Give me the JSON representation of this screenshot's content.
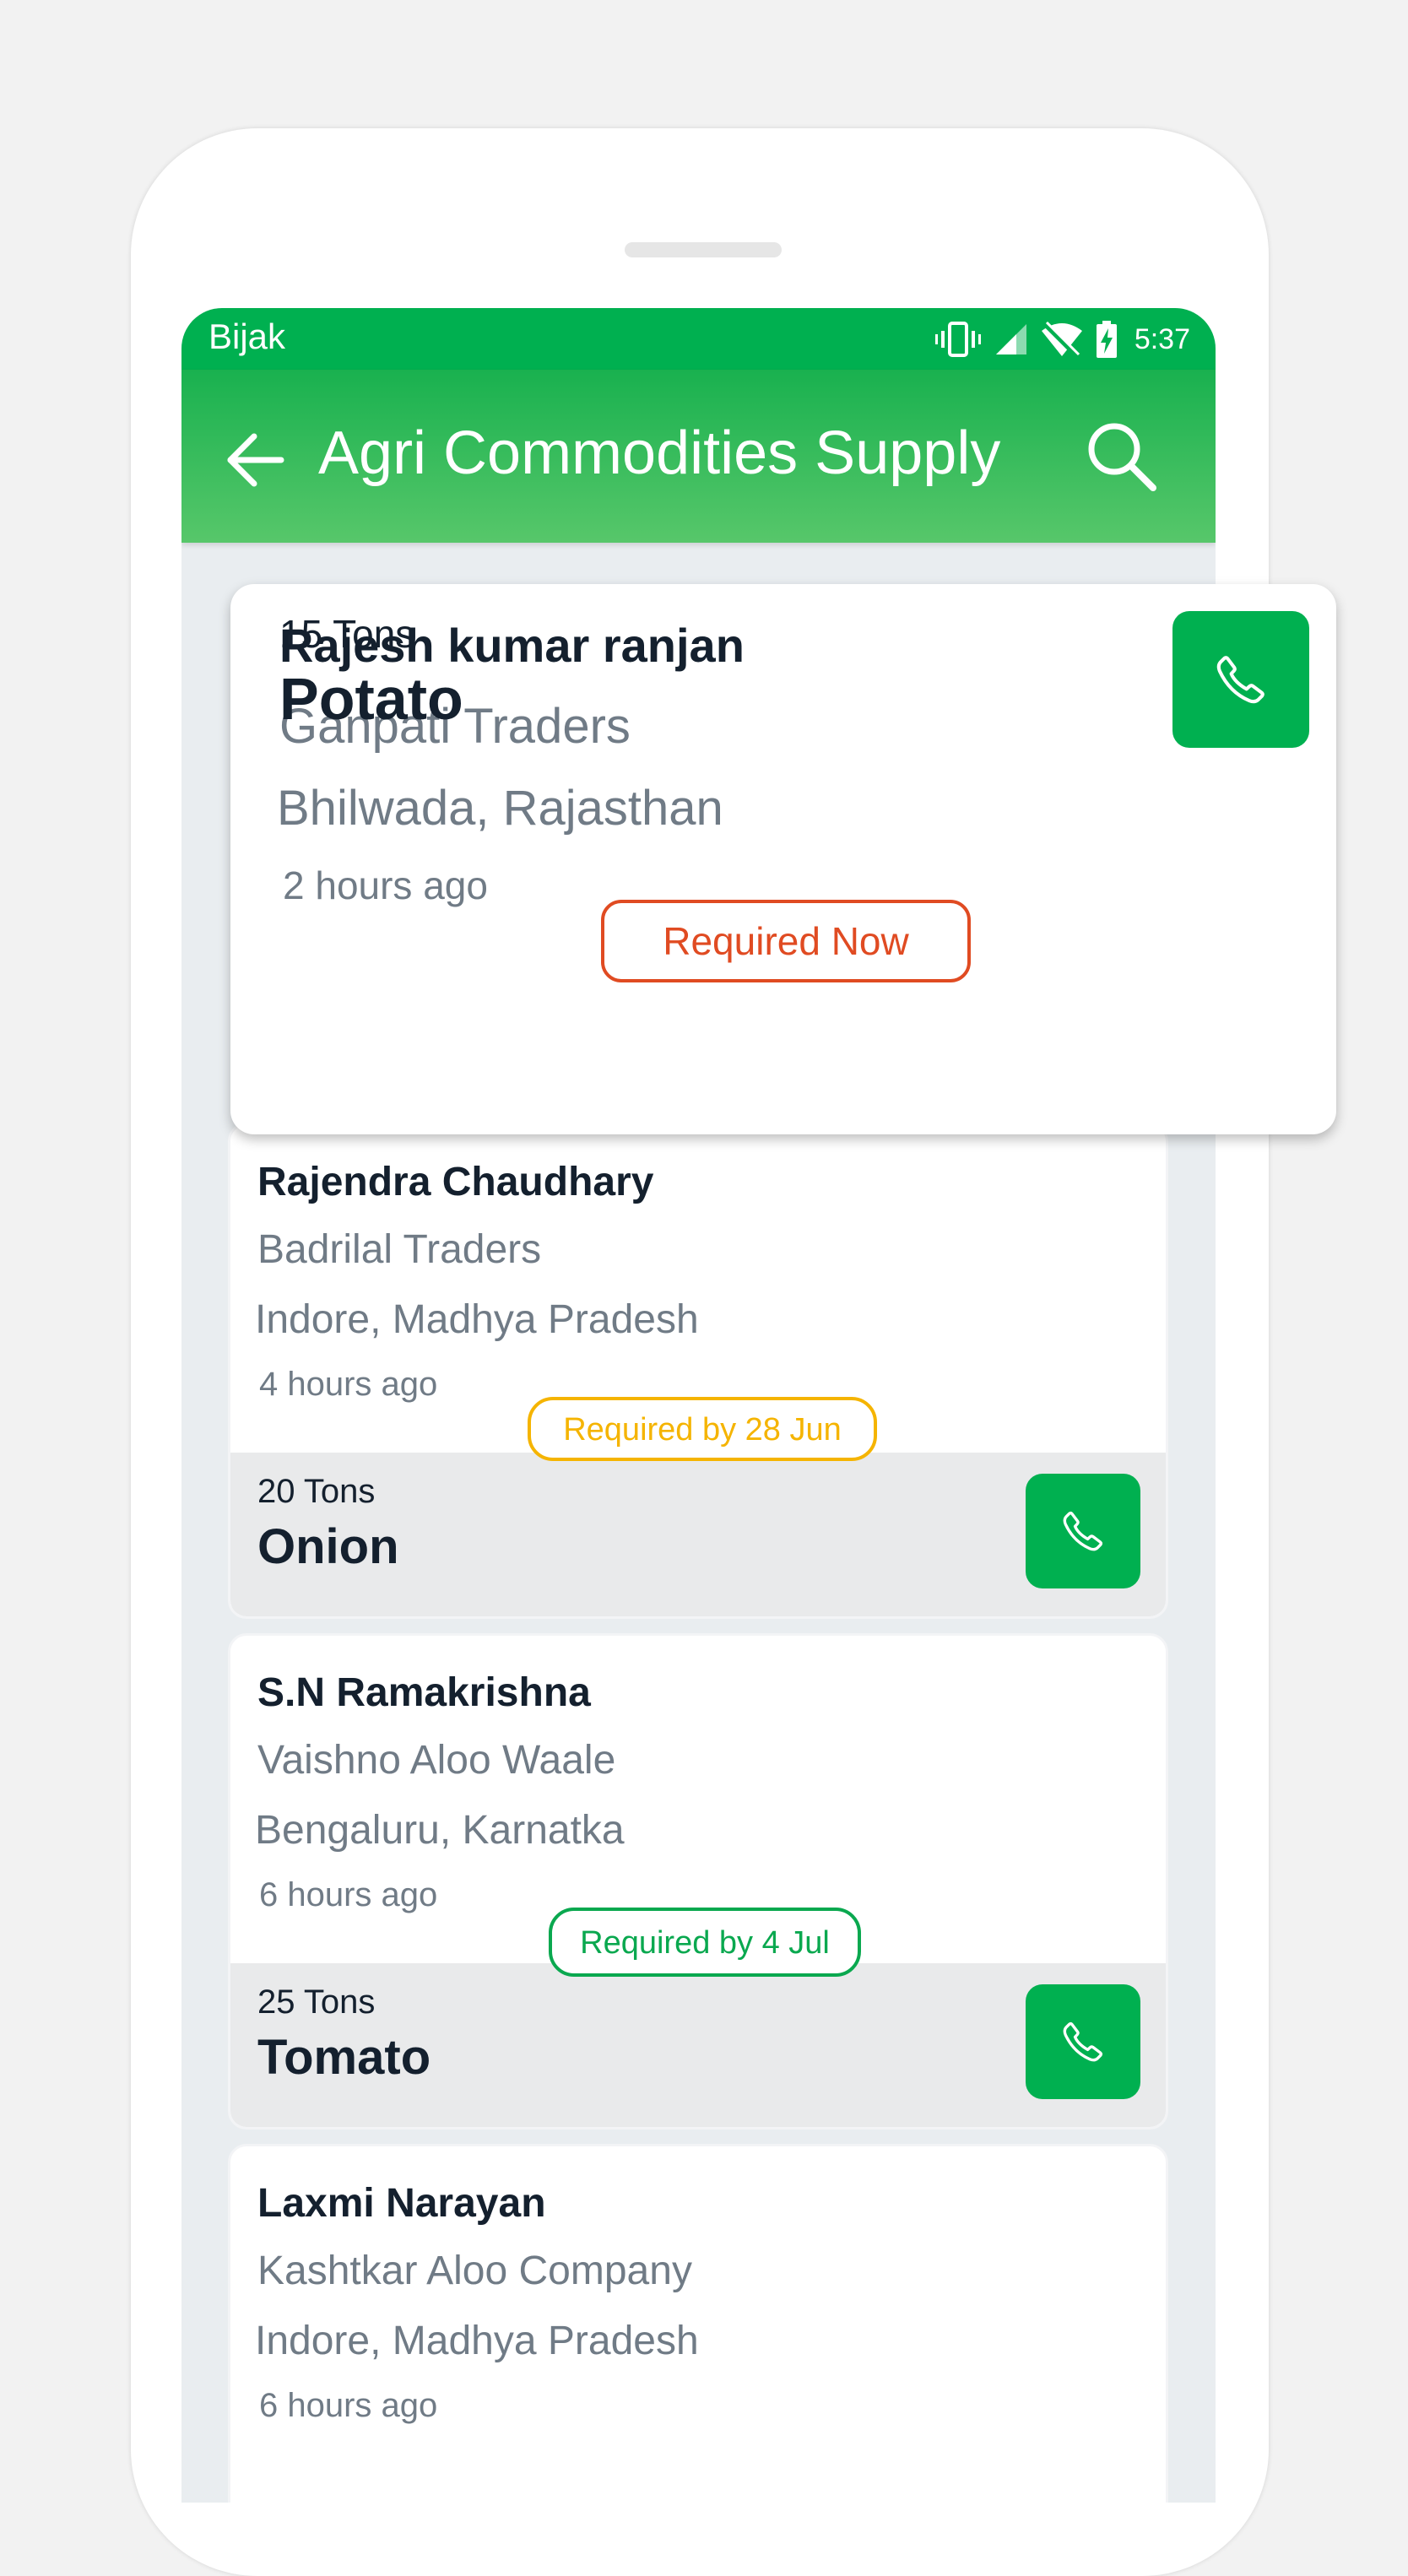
{
  "status_bar": {
    "app_name": "Bijak",
    "time": "5:37"
  },
  "app_bar": {
    "title": "Agri Commodities Supply"
  },
  "colors": {
    "brand_green": "#00b050",
    "urgent": "#e04b22",
    "soon": "#f5b400",
    "later": "#0aa84f"
  },
  "listings": [
    {
      "name": "Rajesh kumar ranjan",
      "company": "Ganpati Traders",
      "location": "Bhilwada, Rajasthan",
      "time": "2 hours ago",
      "badge": "Required Now",
      "quantity": "15 Tons",
      "commodity": "Potato"
    },
    {
      "name": "Rajendra Chaudhary",
      "company": "Badrilal Traders",
      "location": "Indore, Madhya Pradesh",
      "time": "4 hours ago",
      "badge": "Required by 28 Jun",
      "quantity": "20 Tons",
      "commodity": "Onion"
    },
    {
      "name": "S.N Ramakrishna",
      "company": "Vaishno Aloo Waale",
      "location": "Bengaluru, Karnatka",
      "time": "6 hours ago",
      "badge": "Required by 4 Jul",
      "quantity": "25 Tons",
      "commodity": "Tomato"
    },
    {
      "name": "Laxmi Narayan",
      "company": "Kashtkar Aloo Company",
      "location": "Indore, Madhya Pradesh",
      "time": "6 hours ago"
    }
  ]
}
